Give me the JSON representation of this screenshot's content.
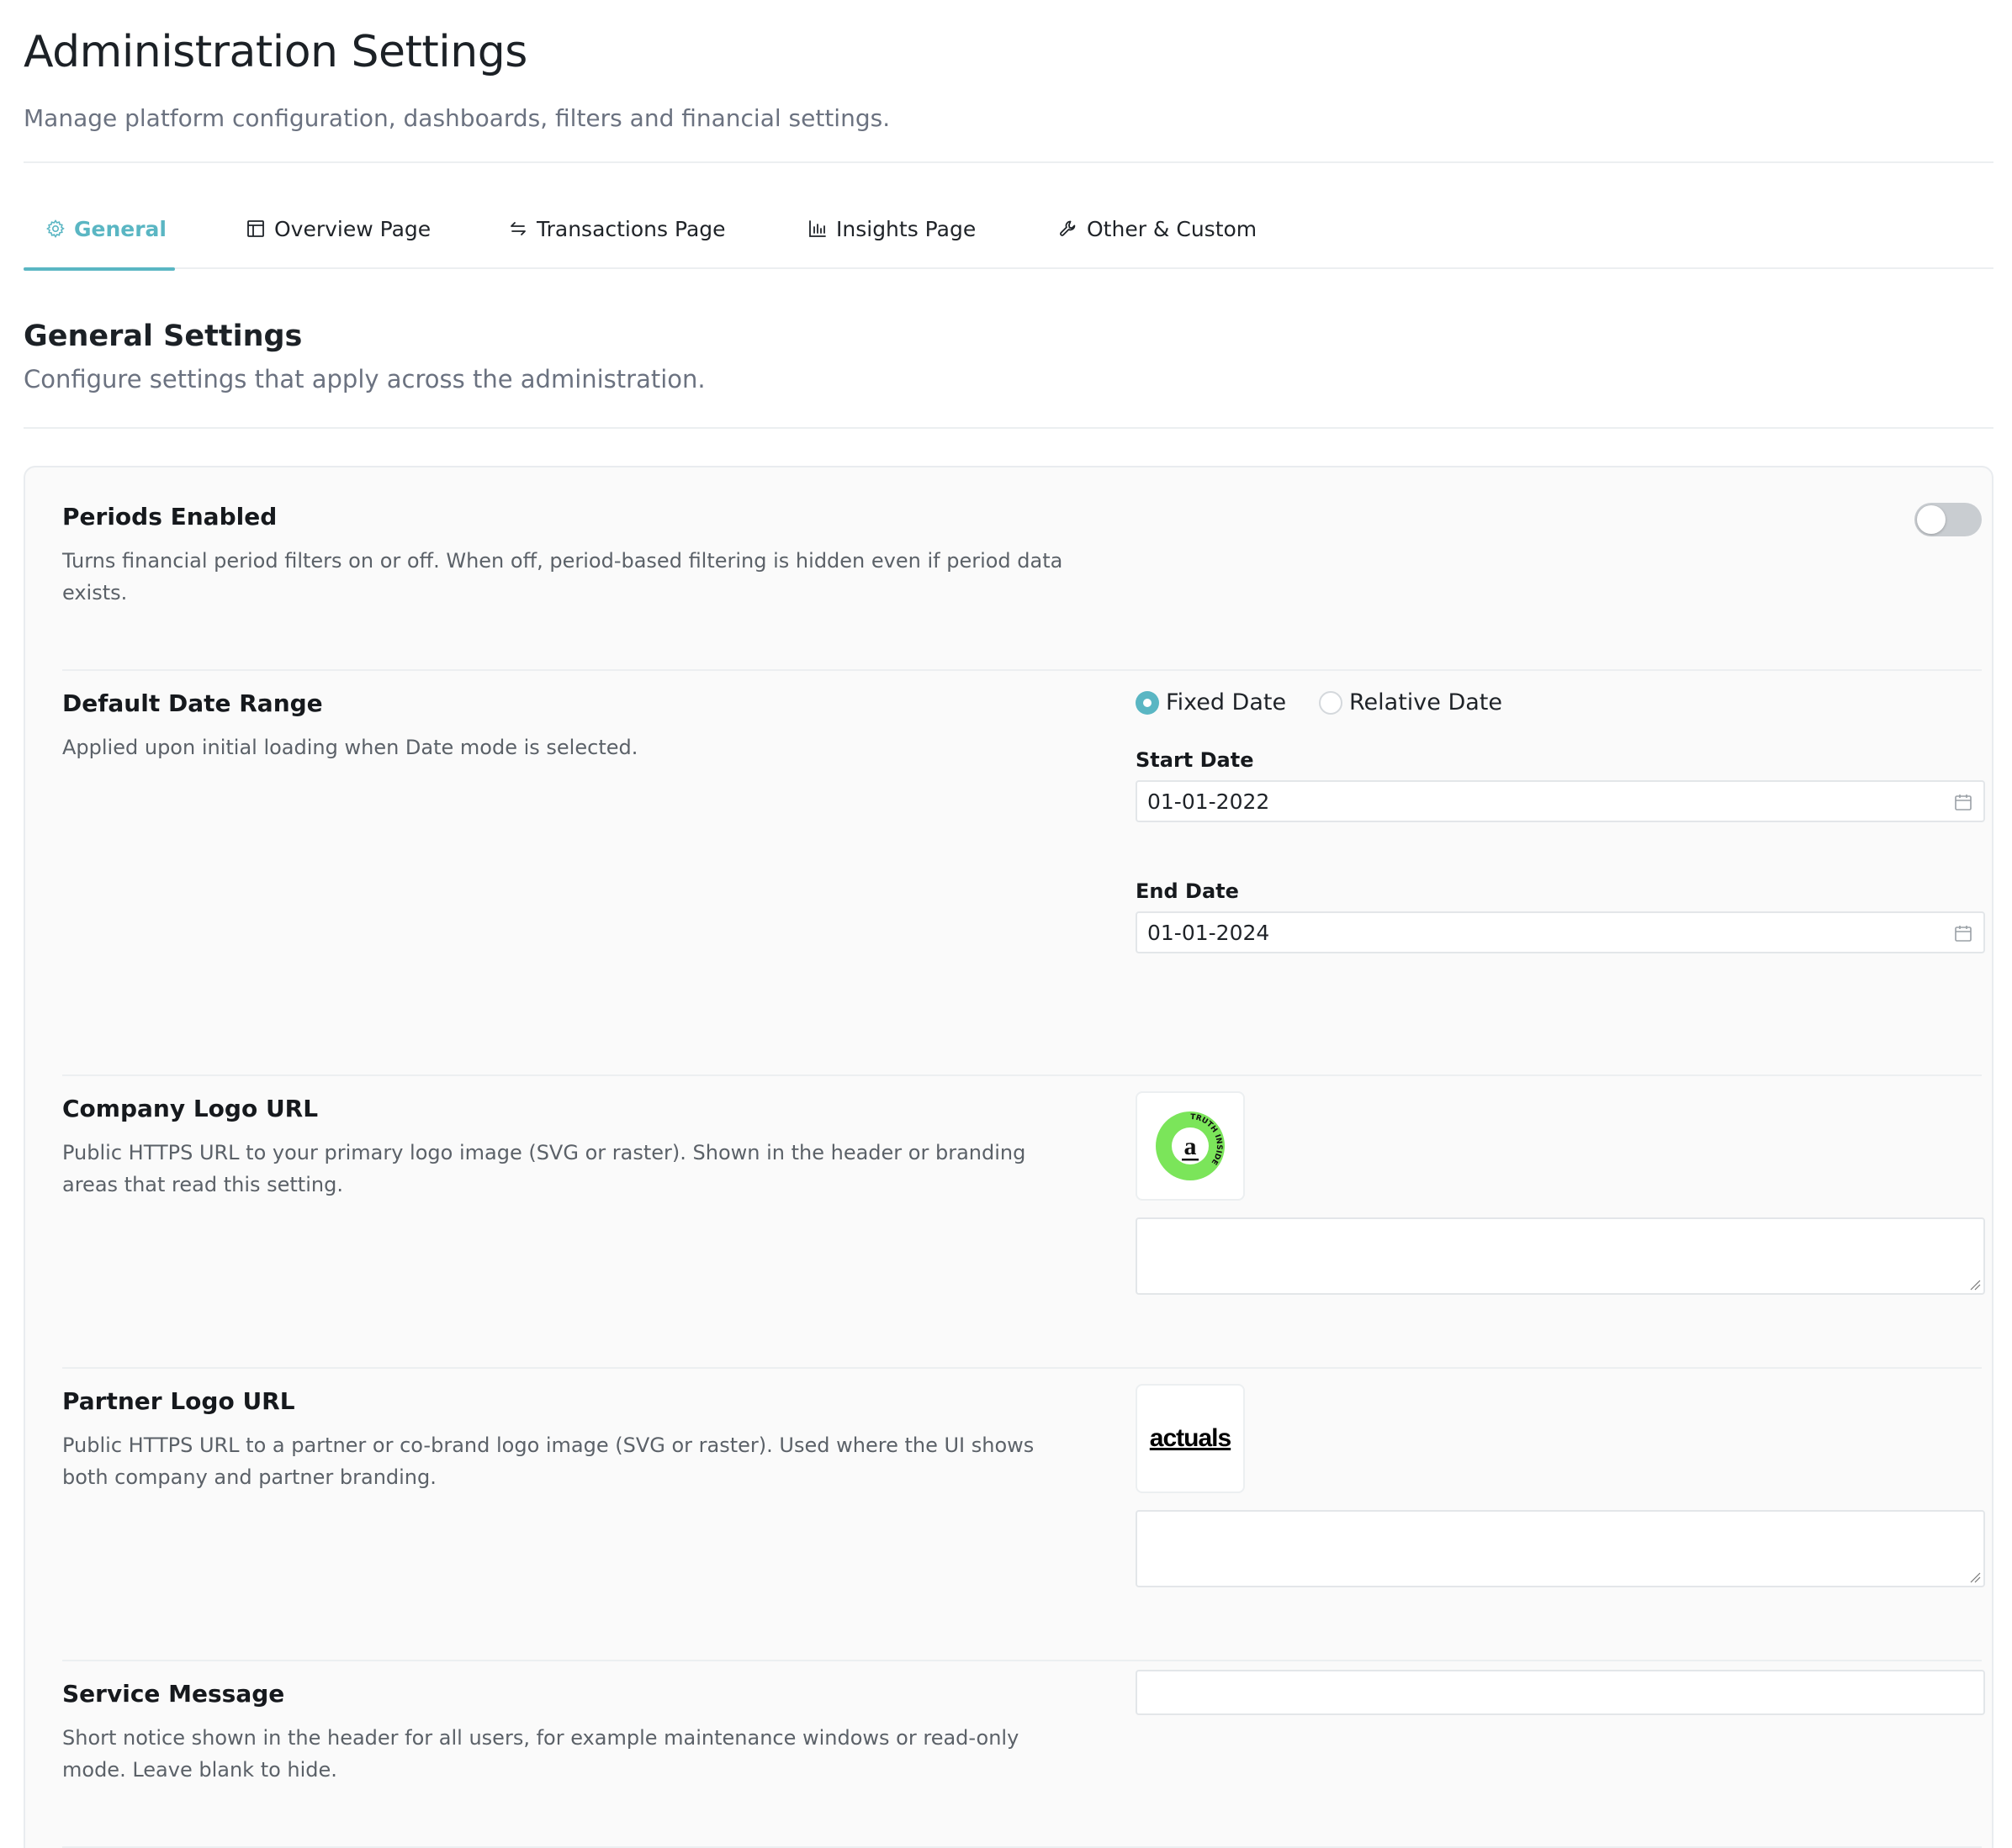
{
  "header": {
    "title": "Administration Settings",
    "subtitle": "Manage platform configuration, dashboards, filters and financial settings."
  },
  "tabs": [
    {
      "label": "General",
      "icon": "gear-icon",
      "active": true
    },
    {
      "label": "Overview Page",
      "icon": "layout-icon",
      "active": false
    },
    {
      "label": "Transactions Page",
      "icon": "arrows-swap-icon",
      "active": false
    },
    {
      "label": "Insights Page",
      "icon": "bar-chart-icon",
      "active": false
    },
    {
      "label": "Other & Custom",
      "icon": "wrench-icon",
      "active": false
    }
  ],
  "section": {
    "title": "General Settings",
    "description": "Configure settings that apply across the administration."
  },
  "settings": {
    "periods": {
      "label": "Periods Enabled",
      "description": "Turns financial period filters on or off. When off, period-based filtering is hidden even if period data exists.",
      "enabled": false
    },
    "date_range": {
      "label": "Default Date Range",
      "description": "Applied upon initial loading when Date mode is selected.",
      "mode_options": [
        "Fixed Date",
        "Relative Date"
      ],
      "selected_mode": "Fixed Date",
      "start_label": "Start Date",
      "start_value": "01-01-2022",
      "end_label": "End Date",
      "end_value": "01-01-2024"
    },
    "company_logo": {
      "label": "Company Logo URL",
      "description": "Public HTTPS URL to your primary logo image (SVG or raster). Shown in the header or branding areas that read this setting.",
      "logo_text": "a",
      "logo_ring_text": "TRUTH INSIDE",
      "value": ""
    },
    "partner_logo": {
      "label": "Partner Logo URL",
      "description": "Public HTTPS URL to a partner or co-brand logo image (SVG or raster). Used where the UI shows both company and partner branding.",
      "logo_text": "actuals",
      "value": ""
    },
    "service_message": {
      "label": "Service Message",
      "description": "Short notice shown in the header for all users, for example maintenance windows or read-only mode. Leave blank to hide.",
      "value": ""
    }
  },
  "colors": {
    "accent": "#5ab6c3",
    "logo_green": "#7be55a"
  }
}
